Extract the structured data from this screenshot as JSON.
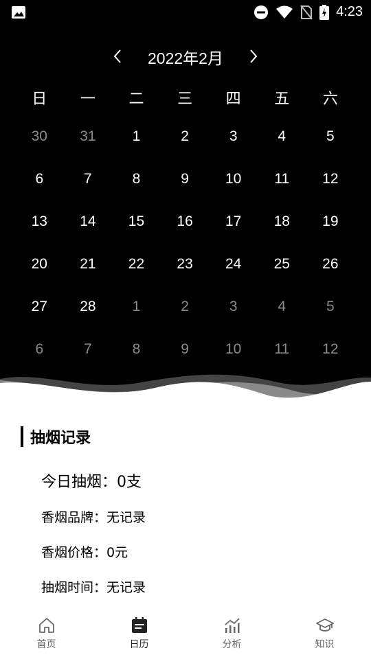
{
  "status_bar": {
    "time": "4:23",
    "icons": [
      "gallery-icon",
      "do-not-disturb-icon",
      "wifi-icon",
      "no-sim-icon",
      "battery-charging-icon"
    ]
  },
  "calendar": {
    "month_label": "2022年2月",
    "weekdays": [
      "日",
      "一",
      "二",
      "三",
      "四",
      "五",
      "六"
    ],
    "weeks": [
      [
        {
          "d": "30",
          "m": true
        },
        {
          "d": "31",
          "m": true
        },
        {
          "d": "1",
          "m": false
        },
        {
          "d": "2",
          "m": false
        },
        {
          "d": "3",
          "m": false
        },
        {
          "d": "4",
          "m": false
        },
        {
          "d": "5",
          "m": false
        }
      ],
      [
        {
          "d": "6",
          "m": false
        },
        {
          "d": "7",
          "m": false
        },
        {
          "d": "8",
          "m": false
        },
        {
          "d": "9",
          "m": false
        },
        {
          "d": "10",
          "m": false
        },
        {
          "d": "11",
          "m": false
        },
        {
          "d": "12",
          "m": false
        }
      ],
      [
        {
          "d": "13",
          "m": false
        },
        {
          "d": "14",
          "m": false
        },
        {
          "d": "15",
          "m": false
        },
        {
          "d": "16",
          "m": false
        },
        {
          "d": "17",
          "m": false
        },
        {
          "d": "18",
          "m": false
        },
        {
          "d": "19",
          "m": false
        }
      ],
      [
        {
          "d": "20",
          "m": false
        },
        {
          "d": "21",
          "m": false
        },
        {
          "d": "22",
          "m": false
        },
        {
          "d": "23",
          "m": false
        },
        {
          "d": "24",
          "m": false
        },
        {
          "d": "25",
          "m": false
        },
        {
          "d": "26",
          "m": false
        }
      ],
      [
        {
          "d": "27",
          "m": false
        },
        {
          "d": "28",
          "m": false
        },
        {
          "d": "1",
          "m": true
        },
        {
          "d": "2",
          "m": true
        },
        {
          "d": "3",
          "m": true
        },
        {
          "d": "4",
          "m": true
        },
        {
          "d": "5",
          "m": true
        }
      ],
      [
        {
          "d": "6",
          "m": true
        },
        {
          "d": "7",
          "m": true
        },
        {
          "d": "8",
          "m": true
        },
        {
          "d": "9",
          "m": true
        },
        {
          "d": "10",
          "m": true
        },
        {
          "d": "11",
          "m": true
        },
        {
          "d": "12",
          "m": true
        }
      ]
    ]
  },
  "record": {
    "title": "抽烟记录",
    "today": "今日抽烟：0支",
    "brand": "香烟品牌：无记录",
    "price": "香烟价格：0元",
    "time": "抽烟时间：无记录"
  },
  "tabs": [
    {
      "label": "首页",
      "icon": "home-icon"
    },
    {
      "label": "日历",
      "icon": "calendar-icon"
    },
    {
      "label": "分析",
      "icon": "chart-icon"
    },
    {
      "label": "知识",
      "icon": "graduation-cap-icon"
    }
  ],
  "colors": {
    "background_top": "#000000",
    "muted_day": "#8a8a8a",
    "tab_label": "#666666"
  }
}
